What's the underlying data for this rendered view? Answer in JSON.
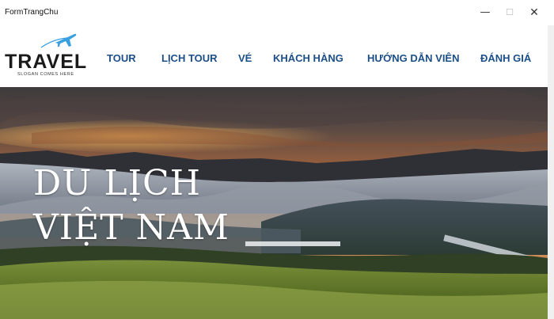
{
  "window": {
    "title": "FormTrangChu",
    "minimize_glyph": "—",
    "maximize_glyph": "☐",
    "close_glyph": "✕"
  },
  "logo": {
    "text": "TRAVEL",
    "slogan": "SLOGAN COMES HERE",
    "icon": "airplane-icon",
    "accent_color": "#3aa0e0"
  },
  "nav": {
    "items": [
      {
        "label": "TOUR"
      },
      {
        "label": "LỊCH TOUR"
      },
      {
        "label": "VÉ"
      },
      {
        "label": "KHÁCH HÀNG"
      },
      {
        "label": "HƯỚNG DẪN VIÊN"
      },
      {
        "label": "ĐÁNH GIÁ"
      }
    ],
    "color": "#1c4f89"
  },
  "hero": {
    "line1": "DU LỊCH",
    "line2": "VIỆT NAM"
  }
}
